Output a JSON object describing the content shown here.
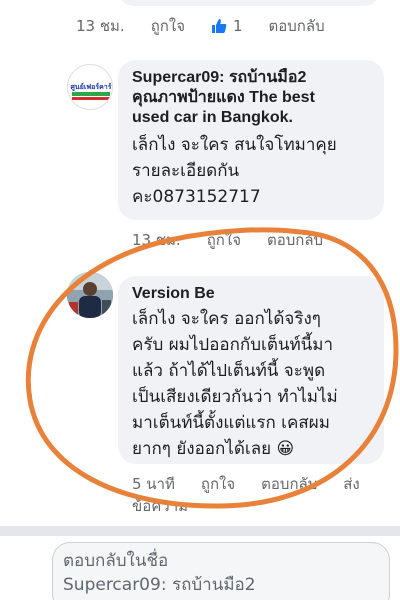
{
  "prev_comment": {
    "time": "13 ชม.",
    "like": "ถูกใจ",
    "like_count": "1",
    "reply": "ตอบกลับ"
  },
  "comment1": {
    "avatar_text": "ศูนย์เฟอร์คาร์",
    "author_line1": "Supercar09: รถบ้านมือ2",
    "author_line2": "คุณภาพป้ายแดง The best",
    "author_line3": "used car in Bangkok.",
    "text_line1": "เล็กไง จะใคร สนใจโทมาคุย",
    "text_line2": "รายละเอียดกัน",
    "text_line3": "คะ0873152717",
    "time": "13 ชม.",
    "like": "ถูกใจ",
    "reply": "ตอบกลับ"
  },
  "comment2": {
    "author": "Version Be",
    "text_line1": "เล็กไง จะใคร ออกได้จริงๆ",
    "text_line2": "ครับ ผมไปออกกับเต็นท์นี้มา",
    "text_line3": "แล้ว  ถ้าได้ไปเต็นท์นี้ จะพูด",
    "text_line4": "เป็นเสียงเดียวกันว่า ทำไมไม่",
    "text_line5": "มาเต็นท์นี้ตั้งแต่แรก เคสผม",
    "text_line6": "ยากๆ ยังออกได้เลย 😀",
    "time": "5 นาที",
    "like": "ถูกใจ",
    "reply": "ตอบกลับ",
    "more": "ส่ง",
    "more2": "ข้อความ"
  },
  "reply_box": {
    "line1": "ตอบกลับในชื่อ",
    "line2": "Supercar09: รถบ้านมือ2"
  },
  "colors": {
    "annotation_circle": "#e8823a",
    "like_blue": "#1877f2"
  }
}
